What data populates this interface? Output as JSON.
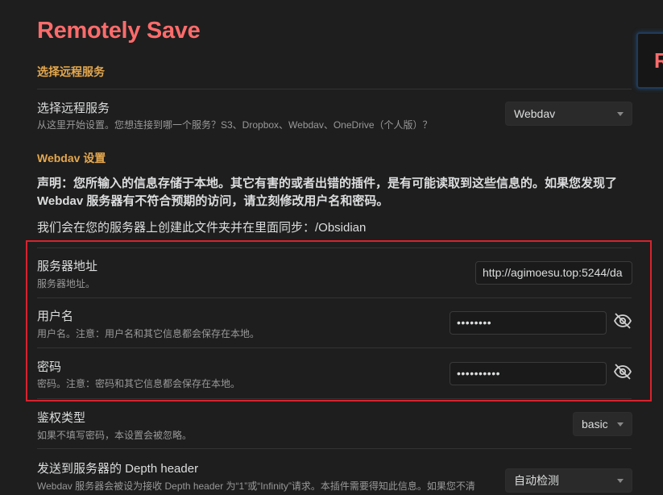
{
  "title": "Remotely Save",
  "side_panel_char": "R",
  "section1": {
    "heading": "选择远程服务"
  },
  "service": {
    "name": "选择远程服务",
    "desc": "从这里开始设置。您想连接到哪一个服务？S3、Dropbox、Webdav、OneDrive（个人版）？",
    "selected": "Webdav"
  },
  "section2": {
    "heading": "Webdav 设置"
  },
  "statement": "声明：您所输入的信息存储于本地。其它有害的或者出错的插件，是有可能读取到这些信息的。如果您发现了 Webdav 服务器有不符合预期的访问，请立刻修改用户名和密码。",
  "sync_text": "我们会在您的服务器上创建此文件夹并在里面同步：/Obsidian",
  "server": {
    "name": "服务器地址",
    "desc": "服务器地址。",
    "value": "http://agimoesu.top:5244/da"
  },
  "username": {
    "name": "用户名",
    "desc": "用户名。注意：用户名和其它信息都会保存在本地。",
    "value": "••••••••"
  },
  "password": {
    "name": "密码",
    "desc": "密码。注意：密码和其它信息都会保存在本地。",
    "value": "••••••••••"
  },
  "auth": {
    "name": "鉴权类型",
    "desc": "如果不填写密码，本设置会被忽略。",
    "selected": "basic"
  },
  "depth": {
    "name": "发送到服务器的 Depth header",
    "desc": "Webdav 服务器会被设为接收 Depth header 为“1”或“Infinity”请求。本插件需要得知此信息。如果您不清",
    "selected": "自动检测"
  },
  "icons": {
    "toggle_visibility": "eye-off-icon"
  },
  "colors": {
    "title": "#ff6b6b",
    "heading": "#e5a84d",
    "highlight": "#d9232e"
  }
}
